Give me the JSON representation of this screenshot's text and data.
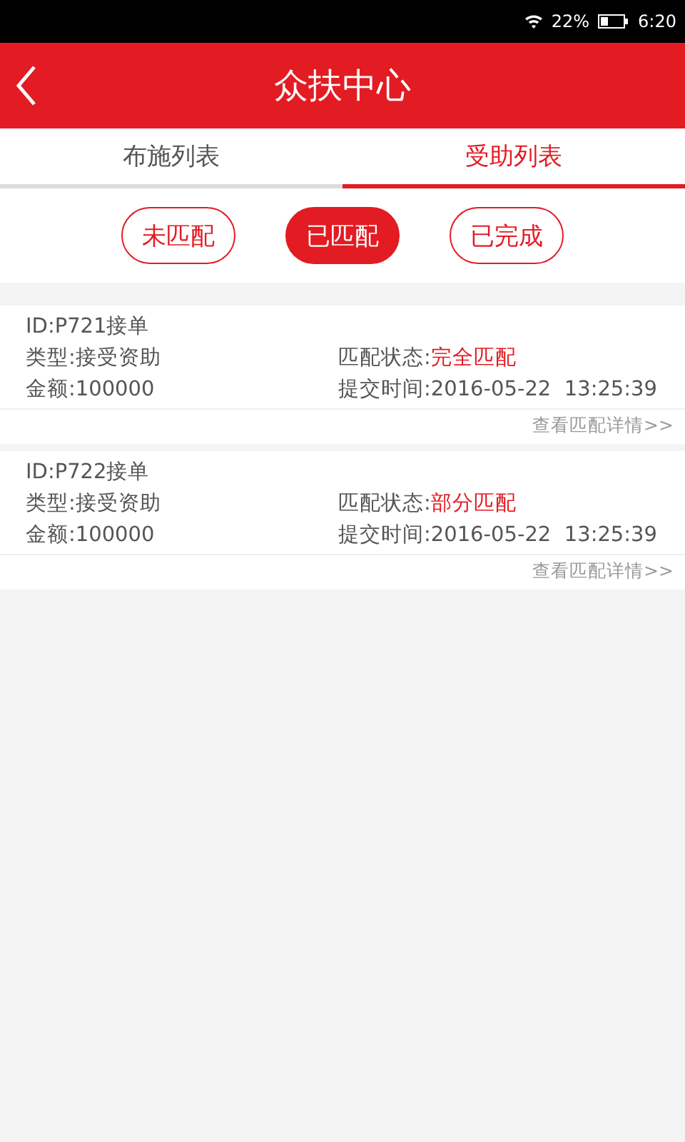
{
  "status_bar": {
    "battery": "22%",
    "time": "6:20"
  },
  "header": {
    "title": "众扶中心"
  },
  "tabs": [
    {
      "label": "布施列表",
      "selected": false
    },
    {
      "label": "受助列表",
      "selected": true
    }
  ],
  "filters": [
    {
      "label": "未匹配",
      "selected": false
    },
    {
      "label": "已匹配",
      "selected": true
    },
    {
      "label": "已完成",
      "selected": false
    }
  ],
  "orders": [
    {
      "id": "ID:P721接单",
      "type": "类型:接受资助",
      "status_label": "匹配状态:",
      "status": "完全匹配",
      "amount": "金额:100000",
      "time": "提交时间:2016-05-22  13:25:39",
      "link": "查看匹配详情>>"
    },
    {
      "id": "ID:P722接单",
      "type": "类型:接受资助",
      "status_label": "匹配状态:",
      "status": "部分匹配",
      "amount": "金额:100000",
      "time": "提交时间:2016-05-22  13:25:39",
      "link": "查看匹配详情>>"
    }
  ]
}
